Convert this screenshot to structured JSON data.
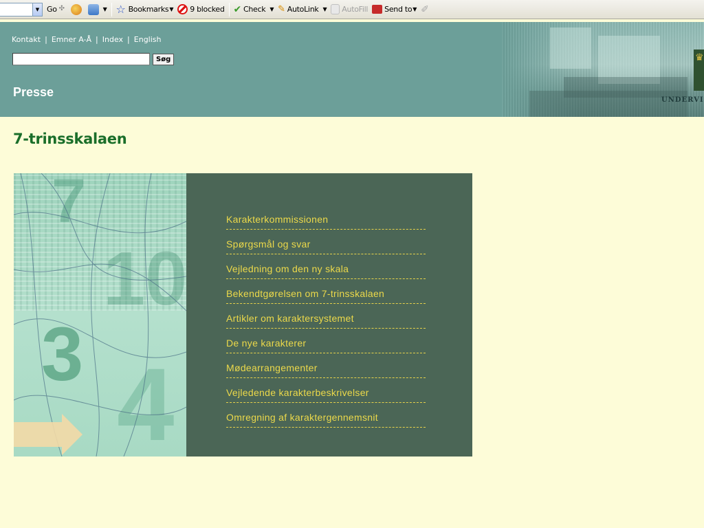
{
  "browser_toolbar": {
    "go_label": "Go",
    "bookmarks_label": "Bookmarks",
    "blocked_label": "9 blocked",
    "check_label": "Check",
    "autolink_label": "AutoLink",
    "autofill_label": "AutoFill",
    "sendto_label": "Send to",
    "icons": [
      "go-arrow-icon",
      "smiley-icon",
      "puzzle-icon",
      "star-icon",
      "popup-blocker-icon",
      "spellcheck-icon",
      "autolink-icon",
      "autofill-icon",
      "send-to-icon",
      "paperclip-icon"
    ]
  },
  "header": {
    "topnav": {
      "kontakt": "Kontakt",
      "emner": "Emner A-Å",
      "index": "Index",
      "english": "English"
    },
    "search": {
      "value": "",
      "button_label": "Søg"
    },
    "section_title": "Presse",
    "ministry_label": "UNDERVI"
  },
  "main": {
    "page_title": "7-trinsskalaen",
    "menu": [
      {
        "label": "Karakterkommissionen"
      },
      {
        "label": "Spørgsmål og svar"
      },
      {
        "label": "Vejledning om den ny skala"
      },
      {
        "label": "Bekendtgørelsen om 7-trinsskalaen"
      },
      {
        "label": "Artikler om karaktersystemet"
      },
      {
        "label": "De nye karakterer"
      },
      {
        "label": "Mødearrangementer"
      },
      {
        "label": "Vejledende karakterbeskrivelser"
      },
      {
        "label": "Omregning af karaktergennemsnit"
      }
    ]
  },
  "colors": {
    "page_bg": "#fdfcd8",
    "header_bg": "#6c9f99",
    "title_green": "#1a6e2a",
    "menu_bg": "#4b6656",
    "menu_link": "#ecd94a"
  }
}
